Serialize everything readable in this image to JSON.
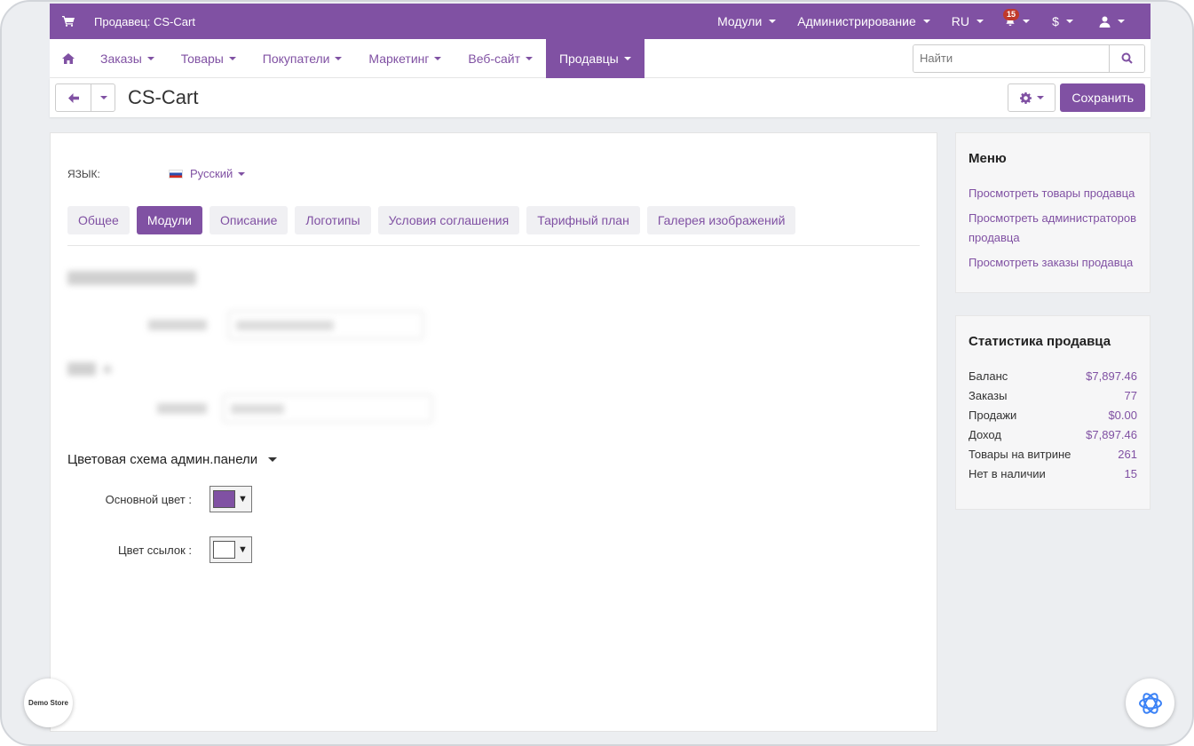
{
  "topbar": {
    "vendor_label": "Продавец: CS-Cart",
    "menu": [
      "Модули",
      "Администрирование",
      "RU"
    ],
    "notifications_count": "15",
    "currency": "$"
  },
  "navbar": {
    "items": [
      "Заказы",
      "Товары",
      "Покупатели",
      "Маркетинг",
      "Веб-сайт",
      "Продавцы"
    ],
    "active": "Продавцы",
    "search_placeholder": "Найти"
  },
  "subbar": {
    "title": "CS-Cart",
    "save_label": "Сохранить"
  },
  "main": {
    "language_label": "Язык:",
    "language_value": "Русский",
    "tabs": [
      "Общее",
      "Модули",
      "Описание",
      "Логотипы",
      "Условия соглашения",
      "Тарифный план",
      "Галерея изображений"
    ],
    "active_tab": "Модули",
    "color_section_title": "Цветовая схема админ.панели",
    "primary_color_label": "Основной цвет :",
    "primary_color_value": "#8051a3",
    "link_color_label": "Цвет ссылок :",
    "link_color_value": "#ffffff"
  },
  "sidebar": {
    "menu_title": "Меню",
    "menu_links": [
      "Просмотреть товары продавца",
      "Просмотреть администраторов продавца",
      "Просмотреть заказы продавца"
    ],
    "stats_title": "Статистика продавца",
    "stats": [
      {
        "label": "Баланс",
        "value": "$7,897.46"
      },
      {
        "label": "Заказы",
        "value": "77"
      },
      {
        "label": "Продажи",
        "value": "$0.00"
      },
      {
        "label": "Доход",
        "value": "$7,897.46"
      },
      {
        "label": "Товары на витрине",
        "value": "261"
      },
      {
        "label": "Нет в наличии",
        "value": "15"
      }
    ]
  },
  "overlay": {
    "demo_badge_text": "Demo Store"
  },
  "colors": {
    "accent": "#8051a3",
    "background": "#eceef1"
  }
}
